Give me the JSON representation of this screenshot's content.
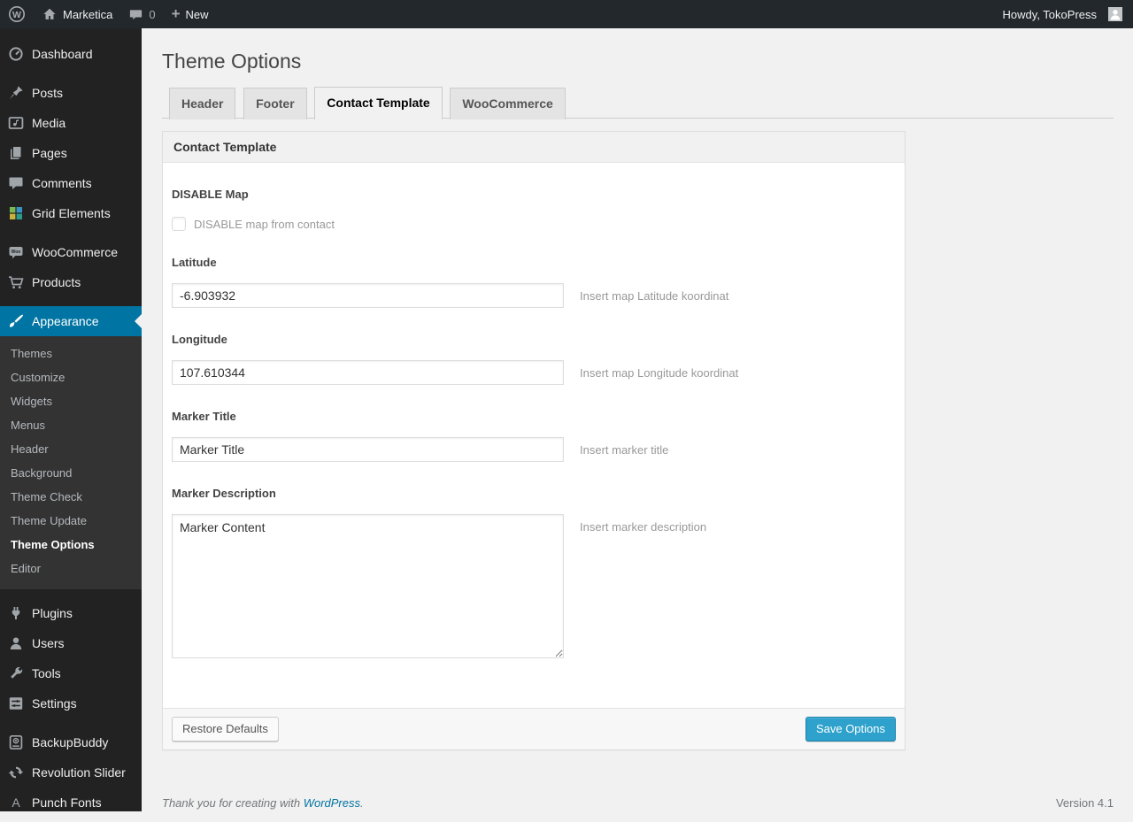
{
  "admin_bar": {
    "site_name": "Marketica",
    "comment_count": "0",
    "new_label": "New",
    "howdy": "Howdy, TokoPress",
    "icons": [
      "wordpress-logo",
      "home-icon",
      "comment-bubble-icon",
      "plus-icon",
      "avatar"
    ]
  },
  "page": {
    "title": "Theme Options"
  },
  "tabs": [
    {
      "label": "Header",
      "active": false
    },
    {
      "label": "Footer",
      "active": false
    },
    {
      "label": "Contact Template",
      "active": true
    },
    {
      "label": "WooCommerce",
      "active": false
    }
  ],
  "panel": {
    "header": "Contact Template",
    "fields": {
      "disable_map": {
        "label": "DISABLE Map",
        "checkbox_label": "DISABLE map from contact",
        "checked": false
      },
      "latitude": {
        "label": "Latitude",
        "value": "-6.903932",
        "help": "Insert map Latitude koordinat"
      },
      "longitude": {
        "label": "Longitude",
        "value": "107.610344",
        "help": "Insert map Longitude koordinat"
      },
      "marker_title": {
        "label": "Marker Title",
        "value": "Marker Title",
        "help": "Insert marker title"
      },
      "marker_description": {
        "label": "Marker Description",
        "value": "Marker Content",
        "help": "Insert marker description"
      }
    },
    "footer": {
      "restore_label": "Restore Defaults",
      "save_label": "Save Options"
    }
  },
  "sidebar": {
    "items": [
      {
        "label": "Dashboard",
        "icon": "dashboard-icon"
      },
      {
        "label": "Posts",
        "icon": "pushpin-icon"
      },
      {
        "label": "Media",
        "icon": "media-icon"
      },
      {
        "label": "Pages",
        "icon": "pages-icon"
      },
      {
        "label": "Comments",
        "icon": "comment-icon"
      },
      {
        "label": "Grid Elements",
        "icon": "grid-icon"
      },
      {
        "label": "WooCommerce",
        "icon": "woocommerce-icon"
      },
      {
        "label": "Products",
        "icon": "cart-icon"
      },
      {
        "label": "Appearance",
        "icon": "brush-icon",
        "active": true
      },
      {
        "label": "Plugins",
        "icon": "plugin-icon"
      },
      {
        "label": "Users",
        "icon": "user-icon"
      },
      {
        "label": "Tools",
        "icon": "wrench-icon"
      },
      {
        "label": "Settings",
        "icon": "settings-icon"
      },
      {
        "label": "BackupBuddy",
        "icon": "backup-icon"
      },
      {
        "label": "Revolution Slider",
        "icon": "refresh-icon"
      },
      {
        "label": "Punch Fonts",
        "icon": "letter-a-icon"
      }
    ],
    "appearance_submenu": [
      {
        "label": "Themes",
        "current": false
      },
      {
        "label": "Customize",
        "current": false
      },
      {
        "label": "Widgets",
        "current": false
      },
      {
        "label": "Menus",
        "current": false
      },
      {
        "label": "Header",
        "current": false
      },
      {
        "label": "Background",
        "current": false
      },
      {
        "label": "Theme Check",
        "current": false
      },
      {
        "label": "Theme Update",
        "current": false
      },
      {
        "label": "Theme Options",
        "current": true
      },
      {
        "label": "Editor",
        "current": false
      }
    ]
  },
  "footer": {
    "thanks_prefix": "Thank you for creating with ",
    "wordpress_link": "WordPress",
    "thanks_suffix": ".",
    "version": "Version 4.1"
  },
  "colors": {
    "accent": "#0074a2",
    "primary_button": "#2ea2cc",
    "admin_bar_bg": "#23282d",
    "sidebar_bg": "#222222",
    "content_bg": "#f1f1f1"
  }
}
